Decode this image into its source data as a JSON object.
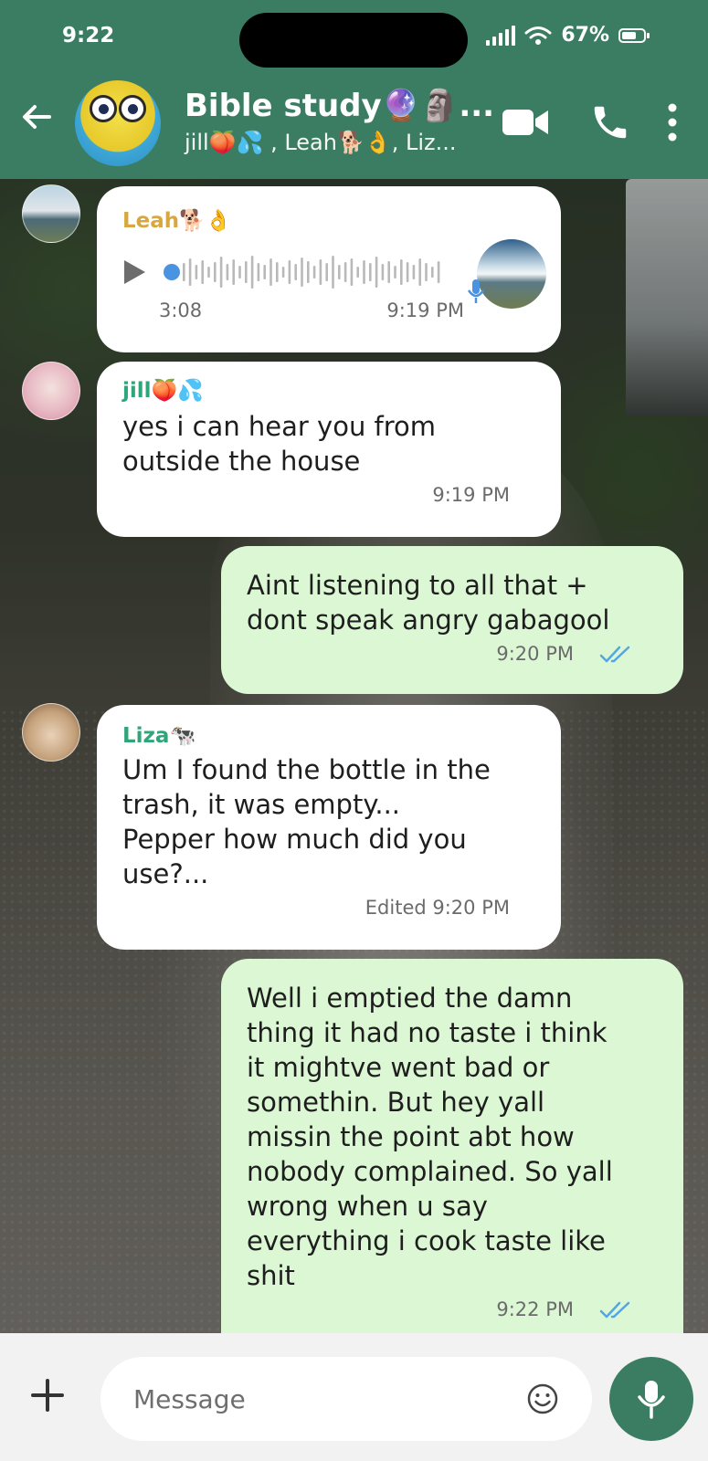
{
  "status_bar": {
    "time": "9:22",
    "battery": "67%",
    "battery_level": 0.67
  },
  "header": {
    "title": "Bible study🔮🗿...",
    "subtitle": "jill🍑💦 , Leah🐕👌, Liz...",
    "icons": [
      "back-arrow-icon",
      "video-call-icon",
      "phone-icon",
      "more-options-icon"
    ]
  },
  "colors": {
    "header": "#3b7d63",
    "incoming_bubble": "#ffffff",
    "outgoing_bubble": "#dbf7d3",
    "tick_read": "#53a6e6"
  },
  "messages": [
    {
      "type": "voice",
      "direction": "in",
      "sender": "Leah🐕👌",
      "sender_color": "#d8a740",
      "duration": "3:08",
      "time": "9:19 PM"
    },
    {
      "type": "text",
      "direction": "in",
      "sender": "jill🍑💦",
      "sender_color": "#2fa67a",
      "lines": [
        "yes i can hear you from",
        "outside the house"
      ],
      "time": "9:19 PM"
    },
    {
      "type": "text",
      "direction": "out",
      "lines": [
        "Aint listening to all that +",
        "dont speak angry gabagool"
      ],
      "time": "9:20 PM",
      "status": "read"
    },
    {
      "type": "text",
      "direction": "in",
      "sender": "Liza🐄",
      "sender_color": "#2fa67a",
      "lines": [
        "Um I found the bottle in the",
        "trash, it was empty...",
        "Pepper how much did you",
        "use?..."
      ],
      "time": "Edited 9:20 PM"
    },
    {
      "type": "text",
      "direction": "out",
      "lines": [
        "Well i emptied the damn",
        "thing it had no taste i think",
        "it mightve went bad or",
        "somethin. But hey yall",
        "missin the point abt how",
        "nobody complained. So yall",
        "wrong when u say",
        "everything i cook taste like",
        "shit"
      ],
      "time": "9:22 PM",
      "status": "read"
    }
  ],
  "composer": {
    "placeholder": "Message"
  }
}
